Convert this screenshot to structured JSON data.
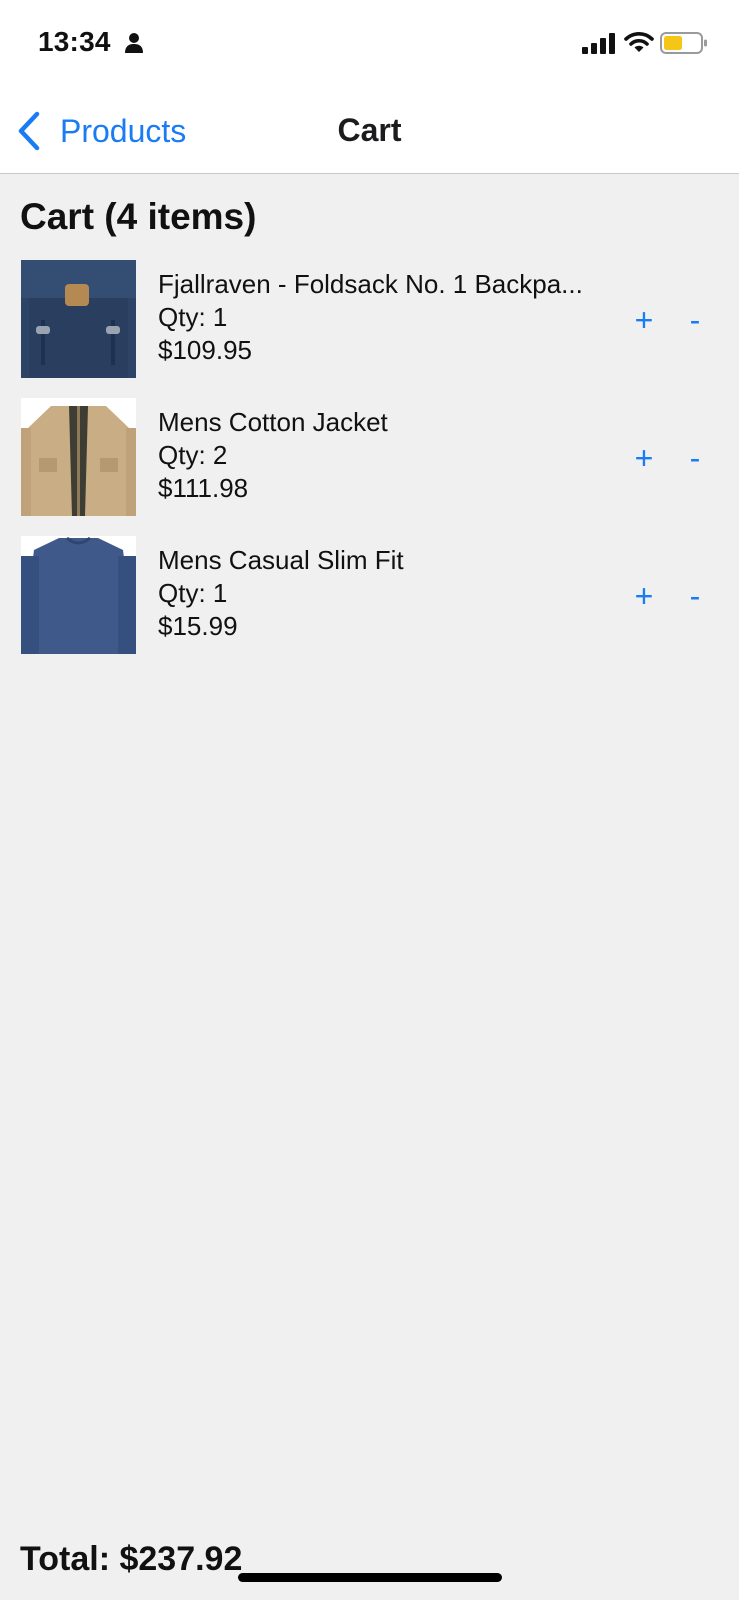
{
  "status_bar": {
    "time": "13:34",
    "icons": [
      "person-icon",
      "signal-icon",
      "wifi-icon",
      "battery-icon"
    ],
    "battery_color": "#f5c518"
  },
  "nav": {
    "back_label": "Products",
    "title": "Cart"
  },
  "cart": {
    "heading": "Cart (4 items)",
    "items": [
      {
        "name": "Fjallraven - Foldsack No. 1 Backpa...",
        "qty": "Qty: 1",
        "price": "$109.95",
        "plus": "+",
        "minus": "-"
      },
      {
        "name": "Mens Cotton Jacket",
        "qty": "Qty: 2",
        "price": "$111.98",
        "plus": "+",
        "minus": "-"
      },
      {
        "name": "Mens Casual Slim Fit",
        "qty": "Qty: 1",
        "price": "$15.99",
        "plus": "+",
        "minus": "-"
      }
    ],
    "total": "Total: $237.92"
  },
  "colors": {
    "accent": "#1a7cf5",
    "background": "#f0f0f0",
    "bar_background": "#ffffff"
  }
}
